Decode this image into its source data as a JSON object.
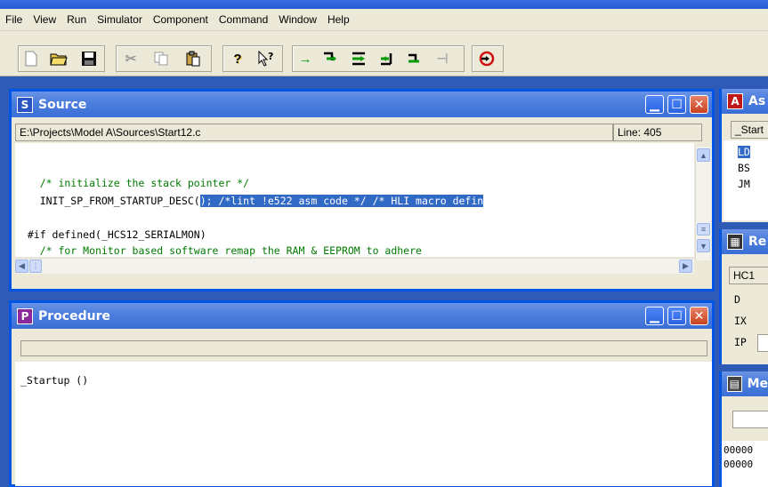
{
  "menu": [
    "File",
    "View",
    "Run",
    "Simulator",
    "Component",
    "Command",
    "Window",
    "Help"
  ],
  "toolbar": {
    "new_icon": "new-file-icon",
    "open_icon": "open-folder-icon",
    "save_icon": "save-disk-icon",
    "cut_icon": "cut-icon",
    "copy_icon": "copy-icon",
    "paste_icon": "paste-icon",
    "help_icon": "help-icon",
    "context_help_icon": "context-help-icon",
    "start_icon": "start-arrow-icon",
    "single_step_icon": "single-step-icon",
    "step_over_icon": "step-over-icon",
    "step_out_icon": "step-out-icon",
    "assembly_step_icon": "assembly-step-icon",
    "halt_icon": "halt-icon",
    "reset_icon": "reset-icon"
  },
  "source": {
    "title": "Source",
    "letter": "S",
    "path": "E:\\Projects\\Model A\\Sources\\Start12.c",
    "line": "Line: 405",
    "lines": {
      "l1": "    /* initialize the stack pointer */",
      "l2_pre": "    INIT_SP_FROM_STARTUP_DESC(",
      "l2_sel": "); /*lint !e522 asm code */ /* HLI macro defin",
      "l3": "  #if defined(_HCS12_SERIALMON)",
      "l4": "    /* for Monitor based software remap the RAM & EEPROM to adhere"
    }
  },
  "procedure": {
    "title": "Procedure",
    "letter": "P",
    "entry": "_Startup ()"
  },
  "assembly": {
    "title": "As",
    "letter": "A",
    "header": "_Start",
    "rows": [
      "LD",
      "BS",
      "JM"
    ]
  },
  "register": {
    "title": "Re",
    "header": "HC1",
    "rows": [
      "D",
      "IX",
      "IP"
    ]
  },
  "memory": {
    "title": "Me",
    "rows": [
      "00000",
      "00000"
    ]
  },
  "colors": {
    "window_frame": "#0055e5",
    "selection": "#316ac5",
    "comment": "#007a00",
    "close_button": "#c8411e"
  }
}
